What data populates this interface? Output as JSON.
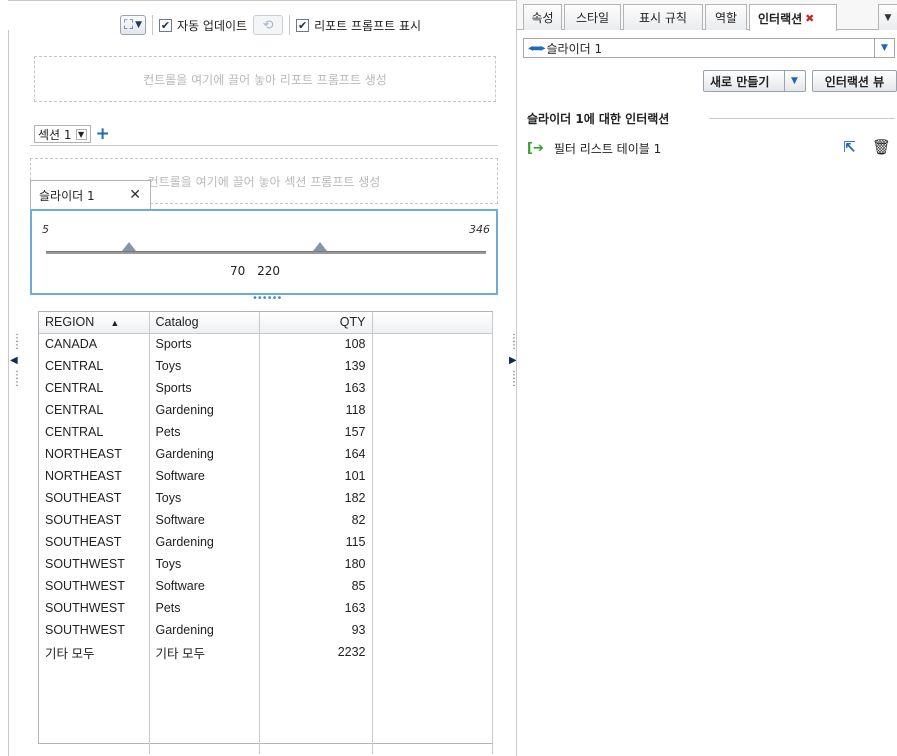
{
  "toolbar": {
    "layout_icon": "layout-icon",
    "auto_update_checked": true,
    "auto_update_label": "자동 업데이트",
    "refresh_icon": "refresh-icon",
    "show_prompts_checked": true,
    "show_prompts_label": "리포트 프롬프트 표시"
  },
  "report_prompt_dropzone": "컨트롤을 여기에 끌어 놓아 리포트 프롬프트 생성",
  "section": {
    "name": "섹션 1",
    "add_icon": "plus-icon"
  },
  "section_prompt_dropzone": "컨트롤을 여기에 끌어 놓아 섹션 프롬프트 생성",
  "slider": {
    "title": "슬라이더 1",
    "min": "5",
    "max": "346",
    "low_value": "70",
    "high_value": "220"
  },
  "table": {
    "columns": [
      "REGION",
      "Catalog",
      "QTY"
    ],
    "sort_icon": "sort-ascending-icon",
    "rows": [
      [
        "CANADA",
        "Sports",
        "108"
      ],
      [
        "CENTRAL",
        "Toys",
        "139"
      ],
      [
        "CENTRAL",
        "Sports",
        "163"
      ],
      [
        "CENTRAL",
        "Gardening",
        "118"
      ],
      [
        "CENTRAL",
        "Pets",
        "157"
      ],
      [
        "NORTHEAST",
        "Gardening",
        "164"
      ],
      [
        "NORTHEAST",
        "Software",
        "101"
      ],
      [
        "SOUTHEAST",
        "Toys",
        "182"
      ],
      [
        "SOUTHEAST",
        "Software",
        "82"
      ],
      [
        "SOUTHEAST",
        "Gardening",
        "115"
      ],
      [
        "SOUTHWEST",
        "Toys",
        "180"
      ],
      [
        "SOUTHWEST",
        "Software",
        "85"
      ],
      [
        "SOUTHWEST",
        "Pets",
        "163"
      ],
      [
        "SOUTHWEST",
        "Gardening",
        "93"
      ],
      [
        "기타 모두",
        "기타 모두",
        "2232"
      ]
    ]
  },
  "right_tabs": {
    "properties": "속성",
    "styles": "스타일",
    "display_rules": "표시 규칙",
    "roles": "역할",
    "interactions": "인터랙션"
  },
  "control_select": "슬라이더 1",
  "new_button": "새로 만들기",
  "interaction_view_button": "인터랙션 뷰",
  "interactions_heading": "슬라이더 1에 대한 인터랙션",
  "interaction_item": "필터 리스트 테이블 1",
  "colors": {
    "accent_blue": "#1e69b8",
    "slider_border": "#6aaed8",
    "close_red": "#c62828",
    "filter_arrow_green": "#3a9b30"
  }
}
